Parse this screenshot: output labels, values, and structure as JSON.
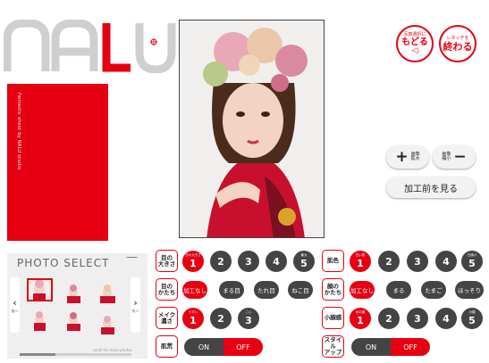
{
  "brand": {
    "logo_text": "NALU",
    "accent": "#e60012"
  },
  "red_panel": {
    "vertical_text": "Fantastic shoot by NALU studio"
  },
  "top_buttons": {
    "back": {
      "small": "写真選択に",
      "main": "もどる",
      "glyph": "◁"
    },
    "finish": {
      "small": "レタッチを",
      "main": "終わる"
    }
  },
  "zoom": {
    "zoom_in": {
      "glyph": "+",
      "label_line1": "画像",
      "label_line2": "拡大"
    },
    "zoom_out": {
      "glyph": "−",
      "label_line1": "画像",
      "label_line2": "縮小"
    }
  },
  "before_button": "加工前を見る",
  "photo_select": {
    "title": "PHOTO SELECT",
    "collapse": "—",
    "prev": "‹",
    "next": "›",
    "prev_sub": "前へ",
    "next_sub": "次へ",
    "scroll_hint": "scroll for more photos"
  },
  "controls": {
    "eye_size": {
      "label": "目の\n大きさ",
      "badge": "元の大きさ",
      "options": [
        "1",
        "2",
        "3",
        "4",
        "5"
      ],
      "selected": "1",
      "end_badge": "最大"
    },
    "eye_shape": {
      "label": "目の\nかたち",
      "options": [
        "加工なし",
        "まる目",
        "たれ目",
        "ねこ目"
      ],
      "selected": "加工なし"
    },
    "makeup": {
      "label": "メイク\n濃さ",
      "badge": "うすい",
      "options": [
        "1",
        "2",
        "3"
      ],
      "selected": "1",
      "end_badge": "こい"
    },
    "blemish": {
      "label": "肌荒",
      "options": [
        "ON",
        "OFF"
      ],
      "selected": "OFF"
    },
    "skin_color": {
      "label": "肌色",
      "badge": "白い肌",
      "options": [
        "1",
        "2",
        "3",
        "4",
        "5"
      ],
      "selected": "1",
      "end_badge": "日焼け"
    },
    "face_shape": {
      "label": "顔の\nかたち",
      "options": [
        "加工なし",
        "まる",
        "たまご",
        "ほっそり"
      ],
      "selected": "加工なし"
    },
    "face_size": {
      "label": "小顔感",
      "badge": "元の顔",
      "options": [
        "1",
        "2",
        "3",
        "4",
        "5"
      ],
      "selected": "1",
      "end_badge": "小顔"
    },
    "style_up": {
      "label": "スタイル\nアップ",
      "options": [
        "ON",
        "OFF"
      ],
      "selected": "OFF"
    }
  }
}
